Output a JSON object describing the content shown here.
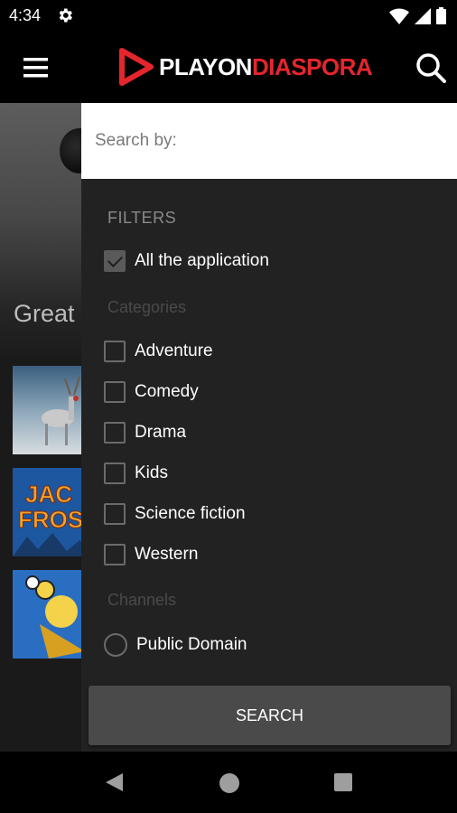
{
  "status_bar": {
    "time": "4:34"
  },
  "app_bar": {
    "logo_part1": "PLAYON",
    "logo_part2": "DIASPORA",
    "brand_color": "#e4262c"
  },
  "background": {
    "hero_title": "Great"
  },
  "drawer": {
    "search_placeholder": "Search by:",
    "filters_header": "FILTERS",
    "all_option": {
      "label": "All the application",
      "checked": true
    },
    "categories_header": "Categories",
    "categories": [
      {
        "label": "Adventure",
        "checked": false
      },
      {
        "label": "Comedy",
        "checked": false
      },
      {
        "label": "Drama",
        "checked": false
      },
      {
        "label": "Kids",
        "checked": false
      },
      {
        "label": "Science fiction",
        "checked": false
      },
      {
        "label": "Western",
        "checked": false
      }
    ],
    "channels_header": "Channels",
    "channels": [
      {
        "label": "Public Domain",
        "selected": false
      }
    ],
    "search_button": "SEARCH"
  }
}
